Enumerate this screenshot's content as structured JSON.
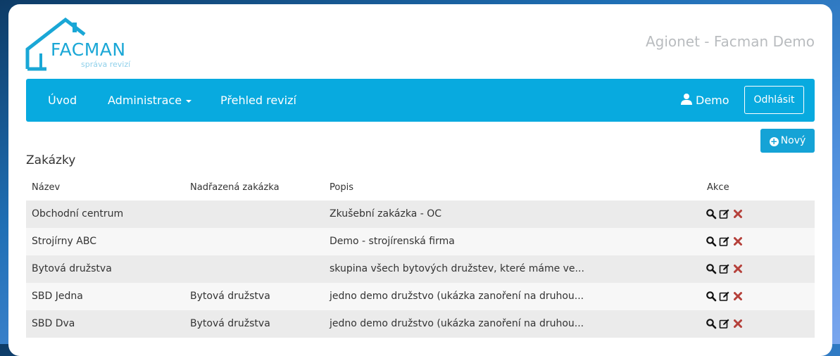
{
  "brand": {
    "name": "FACMAN",
    "tagline": "správa revizí",
    "site_title": "Agionet - Facman Demo",
    "accent_color": "#08aadf"
  },
  "navbar": {
    "items": [
      {
        "label": "Úvod"
      },
      {
        "label": "Administrace"
      },
      {
        "label": "Přehled revizí"
      }
    ],
    "user": "Demo",
    "logout_label": "Odhlásit"
  },
  "toolbar": {
    "new_label": "Nový"
  },
  "page": {
    "title": "Zakázky"
  },
  "table": {
    "headers": [
      "Název",
      "Nadřazená zakázka",
      "Popis",
      "Akce"
    ],
    "rows": [
      {
        "name": "Obchodní centrum",
        "parent": "",
        "description": "Zkušební zakázka - OC"
      },
      {
        "name": "Strojírny ABC",
        "parent": "",
        "description": "Demo - strojírenská firma"
      },
      {
        "name": "Bytová družstva",
        "parent": "",
        "description": "skupina všech bytových družstev, které máme ve..."
      },
      {
        "name": "SBD Jedna",
        "parent": "Bytová družstva",
        "description": "jedno demo družstvo (ukázka zanoření na druhou..."
      },
      {
        "name": "SBD Dva",
        "parent": "Bytová družstva",
        "description": "jedno demo družstvo (ukázka zanoření na druhou..."
      }
    ],
    "action_icons": [
      "search-icon",
      "edit-icon",
      "delete-icon"
    ]
  }
}
